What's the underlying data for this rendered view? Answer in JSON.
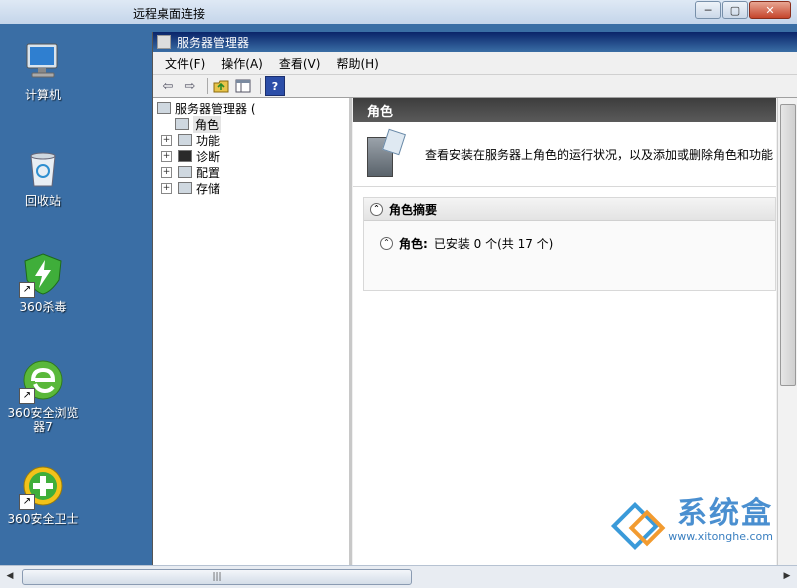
{
  "rdp": {
    "title": "远程桌面连接",
    "min": "─",
    "max": "▢",
    "close": "✕"
  },
  "desktop": {
    "icons": [
      {
        "label": "计算机"
      },
      {
        "label": "回收站"
      },
      {
        "label": "360杀毒"
      },
      {
        "label": "360安全浏览器7"
      },
      {
        "label": "360安全卫士"
      }
    ]
  },
  "server_manager": {
    "title": "服务器管理器",
    "menu": [
      "文件(F)",
      "操作(A)",
      "查看(V)",
      "帮助(H)"
    ],
    "toolbar": {
      "back": "⇦",
      "forward": "⇨",
      "help": "?"
    },
    "tree": {
      "root": "服务器管理器 (",
      "items": [
        {
          "label": "角色",
          "expander": ""
        },
        {
          "label": "功能",
          "expander": "+"
        },
        {
          "label": "诊断",
          "expander": "+"
        },
        {
          "label": "配置",
          "expander": "+"
        },
        {
          "label": "存储",
          "expander": "+"
        }
      ]
    },
    "right": {
      "header": "角色",
      "description": "查看安装在服务器上角色的运行状况，以及添加或删除角色和功能",
      "section_title": "角色摘要",
      "summary_label": "角色:",
      "summary_value": "已安装 0 个(共 17 个)"
    }
  },
  "hscroll": {
    "left": "◀",
    "right": "▶",
    "grip": "|||"
  },
  "watermark": {
    "title": "系统盒",
    "url": "www.xitonghe.com"
  }
}
